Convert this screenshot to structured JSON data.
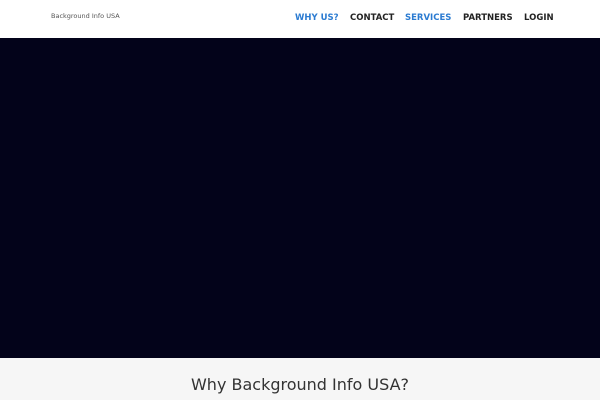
{
  "header": {
    "logo_text": "Background Info USA"
  },
  "nav": {
    "items": [
      {
        "label": "WHY US?",
        "color": "#2b7bd1"
      },
      {
        "label": "CONTACT",
        "color": "#222222"
      },
      {
        "label": "SERVICES",
        "color": "#2b7bd1"
      },
      {
        "label": "PARTNERS",
        "color": "#222222"
      },
      {
        "label": "LOGIN",
        "color": "#222222"
      }
    ]
  },
  "hero": {
    "background_color": "#03031a"
  },
  "section": {
    "title": "Why Background Info USA?"
  }
}
